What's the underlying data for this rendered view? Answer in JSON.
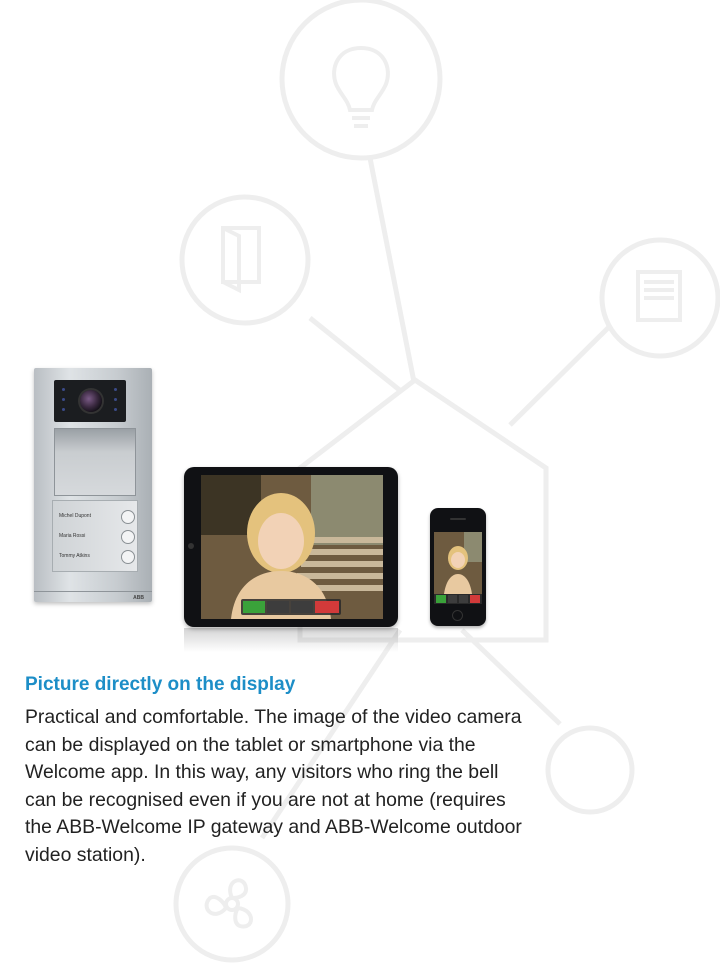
{
  "door_station": {
    "names": [
      "Michel Dupont",
      "Maria Rossi",
      "Tommy Atkins"
    ],
    "logo": "ABB"
  },
  "colors": {
    "heading": "#1d8ec7",
    "body_text": "#222222",
    "background_lines": "#eeeeee",
    "call_accept": "#3aa23a",
    "call_reject": "#d23a3a"
  },
  "icons": [
    "light-bulb-icon",
    "door-icon",
    "blinds-icon",
    "house-outline-icon",
    "fan-icon",
    "accept-call-icon",
    "key-icon",
    "light-icon",
    "end-call-icon"
  ],
  "heading": "Picture directly on the display",
  "body_lines": [
    "Practical and comfortable. The image of the video camera",
    "can be displayed on the tablet or smartphone via the",
    "Welcome app. In this way, any visitors who ring the bell",
    "can be recognised even if you are not at home (requires",
    "the ABB-Welcome IP gateway and ABB-Welcome outdoor",
    "video station)."
  ]
}
